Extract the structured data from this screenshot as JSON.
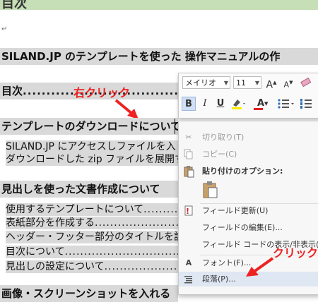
{
  "document": {
    "top_heading": "目次",
    "para_mark": "↵",
    "heading_main": "SILAND.JP のテンプレートを使った 操作マニュアルの作",
    "toc_line": {
      "label": "目次",
      "dots": "..................................."
    },
    "heading_download": "テンプレートのダウンロードについて",
    "download_body": [
      "SILAND.JP にアクセスしファイルを入",
      "ダウンロードした zip ファイルを展開す"
    ],
    "heading_docs": "見出しを使った文書作成について",
    "doc_list": [
      {
        "text": "使用するテンプレートについて",
        "dots": "........................"
      },
      {
        "text": "表紙部分を作成する",
        "dots": "........................................"
      },
      {
        "text": "ヘッダー・フッター部分のタイトルを設",
        "dots": ""
      },
      {
        "text": "目次について",
        "dots": "................................................"
      },
      {
        "text": "見出しの設定について",
        "dots": "...................................."
      }
    ],
    "bottom_cut": "画像・スクリーンショットを入れる"
  },
  "annotations": {
    "right_click": "右クリック",
    "click": "クリック"
  },
  "toolbar": {
    "font_name": "メイリオ",
    "font_size": "11",
    "grow": "A",
    "shrink": "A",
    "bold": "B",
    "italic": "I",
    "underline": "U",
    "font_color": "A"
  },
  "context_menu": {
    "items": [
      {
        "label": "切り取り(T)",
        "icon": "scissors-icon",
        "enabled": false
      },
      {
        "label": "コピー(C)",
        "icon": "copy-icon",
        "enabled": false
      },
      {
        "label": "貼り付けのオプション:",
        "icon": "paste-icon",
        "enabled": true
      },
      {
        "label": "フィールド更新(U)",
        "icon": "update-field-icon",
        "enabled": true
      },
      {
        "label": "フィールドの編集(E)...",
        "icon": "",
        "enabled": true
      },
      {
        "label": "フィールド コードの表示/非表示(T)",
        "icon": "",
        "enabled": true
      },
      {
        "label": "フォント(F)...",
        "icon": "font-icon",
        "enabled": true
      },
      {
        "label": "段落(P)...",
        "icon": "paragraph-icon",
        "enabled": true
      }
    ]
  },
  "colors": {
    "heading_fill": "#d9d9d9",
    "top_strip": "#c6dfb6",
    "annotation_red": "#ee2222",
    "menu_hover": "#dfe7f3",
    "underline_yellow": "#ffeb00",
    "font_red": "#e02020"
  }
}
